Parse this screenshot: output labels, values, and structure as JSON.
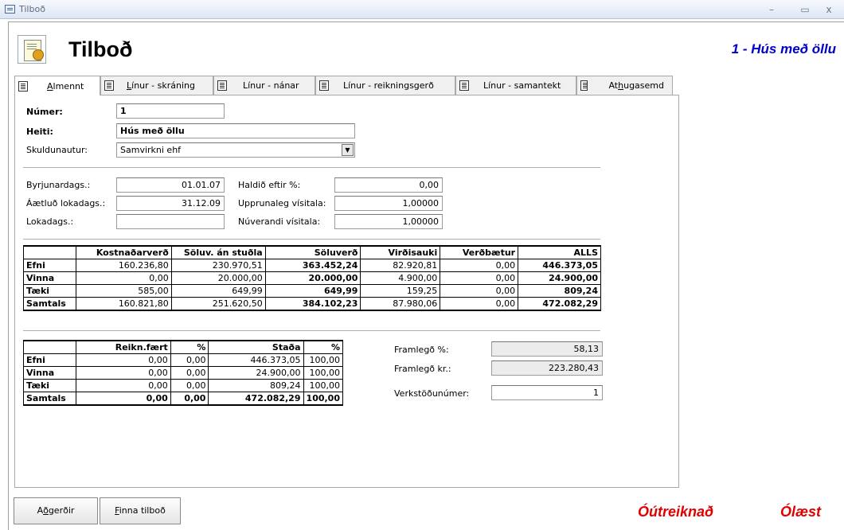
{
  "window": {
    "title": "Tilboð"
  },
  "header": {
    "title": "Tilboð",
    "record_caption": "1 - Hús með öllu"
  },
  "tabs": [
    {
      "label": "Almennt",
      "ul": "A",
      "rest": "lmennt"
    },
    {
      "label": "Línur - skráning",
      "ul": "L",
      "rest": "ínur - skráning"
    },
    {
      "label": "Línur - nánar",
      "ul": "",
      "rest": "Línur - nánar"
    },
    {
      "label": "Línur - reikningsgerð",
      "ul": "",
      "rest": "Línur - reikningsgerð"
    },
    {
      "label": "Línur - samantekt",
      "ul": "",
      "rest": "Línur - samantekt"
    },
    {
      "label": "Athugasemd",
      "pre": "At",
      "ul": "h",
      "rest": "ugasemd"
    }
  ],
  "general": {
    "numer_label": "Númer:",
    "numer_value": "1",
    "heiti_label": "Heiti:",
    "heiti_value": "Hús með öllu",
    "skuldunautur_label": "Skuldunautur:",
    "skuldunautur_value": "Samvirkni ehf"
  },
  "dates": {
    "byrjun_label": "Byrjunardags.:",
    "byrjun_value": "01.01.07",
    "aaetlud_label": "Áætluð lokadags.:",
    "aaetlud_value": "31.12.09",
    "loka_label": "Lokadags.:",
    "loka_value": "",
    "haldid_label": "Haldið eftir %:",
    "haldid_value": "0,00",
    "upprunaleg_label": "Upprunaleg vísitala:",
    "upprunaleg_value": "1,00000",
    "nuverandi_label": "Núverandi vísitala:",
    "nuverandi_value": "1,00000"
  },
  "cost_table": {
    "headers": [
      "",
      "Kostnaðarverð",
      "Söluv. án stuðla",
      "Söluverð",
      "Virðisauki",
      "Verðbætur",
      "ALLS"
    ],
    "rows": [
      [
        "Efni",
        "160.236,80",
        "230.970,51",
        "363.452,24",
        "82.920,81",
        "0,00",
        "446.373,05"
      ],
      [
        "Vinna",
        "0,00",
        "20.000,00",
        "20.000,00",
        "4.900,00",
        "0,00",
        "24.900,00"
      ],
      [
        "Tæki",
        "585,00",
        "649,99",
        "649,99",
        "159,25",
        "0,00",
        "809,24"
      ],
      [
        "Samtals",
        "160.821,80",
        "251.620,50",
        "384.102,23",
        "87.980,06",
        "0,00",
        "472.082,29"
      ]
    ]
  },
  "invoice_table": {
    "headers": [
      "",
      "Reikn.fært",
      "%",
      "Staða",
      "%"
    ],
    "rows": [
      [
        "Efni",
        "0,00",
        "0,00",
        "446.373,05",
        "100,00"
      ],
      [
        "Vinna",
        "0,00",
        "0,00",
        "24.900,00",
        "100,00"
      ],
      [
        "Tæki",
        "0,00",
        "0,00",
        "809,24",
        "100,00"
      ],
      [
        "Samtals",
        "0,00",
        "0,00",
        "472.082,29",
        "100,00"
      ]
    ]
  },
  "margins": {
    "framlegd_pct_label": "Framlegð %:",
    "framlegd_pct_value": "58,13",
    "framlegd_kr_label": "Framlegð kr.:",
    "framlegd_kr_value": "223.280,43",
    "verkstod_label": "Verkstöðunúmer:",
    "verkstod_value": "1"
  },
  "footer": {
    "actions_label": "Aðgerðir",
    "actions_ul": "ð",
    "find_label": "Finna tilboð",
    "find_ul": "F",
    "find_rest": "inna tilboð",
    "status_calc": "Óútreiknað",
    "status_lock": "Ólæst",
    "status_color": "#e00000"
  },
  "colors": {
    "record_caption": "#0000c8"
  }
}
